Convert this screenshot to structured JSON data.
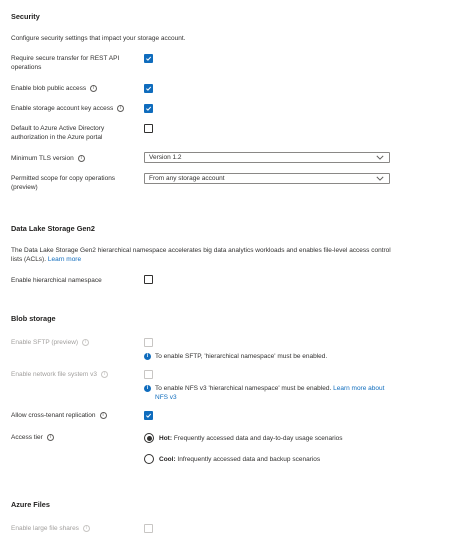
{
  "security": {
    "heading": "Security",
    "description": "Configure security settings that impact your storage account.",
    "require_secure_transfer": {
      "label": "Require secure transfer for REST API operations",
      "checked": true
    },
    "enable_blob_public_access": {
      "label": "Enable blob public access",
      "checked": true
    },
    "enable_account_key_access": {
      "label": "Enable storage account key access",
      "checked": true
    },
    "default_aad_auth": {
      "label": "Default to Azure Active Directory authorization in the Azure portal",
      "checked": false
    },
    "min_tls": {
      "label": "Minimum TLS version",
      "value": "Version 1.2"
    },
    "copy_scope": {
      "label": "Permitted scope for copy operations (preview)",
      "value": "From any storage account"
    }
  },
  "data_lake": {
    "heading": "Data Lake Storage Gen2",
    "description": "The Data Lake Storage Gen2 hierarchical namespace accelerates big data analytics workloads and enables file-level access control lists (ACLs).",
    "learn_more": "Learn more",
    "hierarchical_namespace": {
      "label": "Enable hierarchical namespace",
      "checked": false
    }
  },
  "blob": {
    "heading": "Blob storage",
    "sftp": {
      "label": "Enable SFTP (preview)",
      "checked": false,
      "disabled": true,
      "note": "To enable SFTP, 'hierarchical namespace' must be enabled."
    },
    "nfs": {
      "label": "Enable network file system v3",
      "checked": false,
      "disabled": true,
      "note": "To enable NFS v3 'hierarchical namespace' must be enabled.",
      "note_link": "Learn more about NFS v3"
    },
    "cross_tenant": {
      "label": "Allow cross-tenant replication",
      "checked": true
    },
    "access_tier": {
      "label": "Access tier",
      "options": [
        {
          "name": "Hot:",
          "desc": "Frequently accessed data and day-to-day usage scenarios",
          "selected": true
        },
        {
          "name": "Cool:",
          "desc": "Infrequently accessed data and backup scenarios",
          "selected": false
        }
      ]
    }
  },
  "azure_files": {
    "heading": "Azure Files",
    "large_file_shares": {
      "label": "Enable large file shares",
      "checked": false,
      "disabled": true
    }
  },
  "icons": {
    "info": "info-icon",
    "check": "checkmark-icon",
    "chevron": "chevron-down-icon",
    "note": "info-filled-icon"
  },
  "colors": {
    "accent": "#0f6cbd",
    "text": "#323130",
    "disabled": "#a19f9d"
  }
}
